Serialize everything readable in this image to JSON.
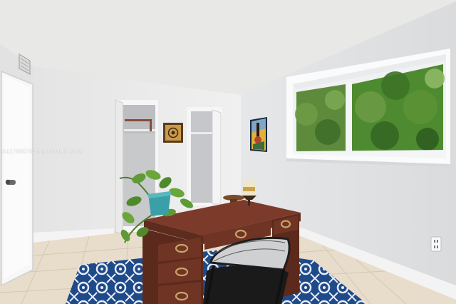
{
  "watermark": {
    "text": "A1179607© Miami MLS 2025"
  },
  "scene": {
    "subject": "",
    "objects": [
      {
        "name": "interior-door",
        "kind": "door"
      },
      {
        "name": "ac-vent",
        "kind": "vent"
      },
      {
        "name": "open-closet-left",
        "kind": "closet"
      },
      {
        "name": "open-closet-right",
        "kind": "closet"
      },
      {
        "name": "framed-art-small",
        "kind": "wall-art"
      },
      {
        "name": "framed-art-painting",
        "kind": "wall-art"
      },
      {
        "name": "window",
        "kind": "window",
        "view": "trees"
      },
      {
        "name": "wooden-desk",
        "kind": "furniture"
      },
      {
        "name": "office-chair",
        "kind": "furniture"
      },
      {
        "name": "potted-plant",
        "kind": "plant"
      },
      {
        "name": "candle",
        "kind": "decor"
      },
      {
        "name": "area-rug",
        "kind": "rug"
      },
      {
        "name": "electrical-outlet",
        "kind": "fixture"
      }
    ],
    "colors": {
      "ceiling": "#e8e8e6",
      "wall_left": "#ededed",
      "wall_right": "#e1e3e5",
      "floor_tile": "#e8dccb",
      "desk_wood": "#6b3426",
      "rug_blue": "#1f4a8a",
      "foliage": "#4e8a2f"
    }
  }
}
